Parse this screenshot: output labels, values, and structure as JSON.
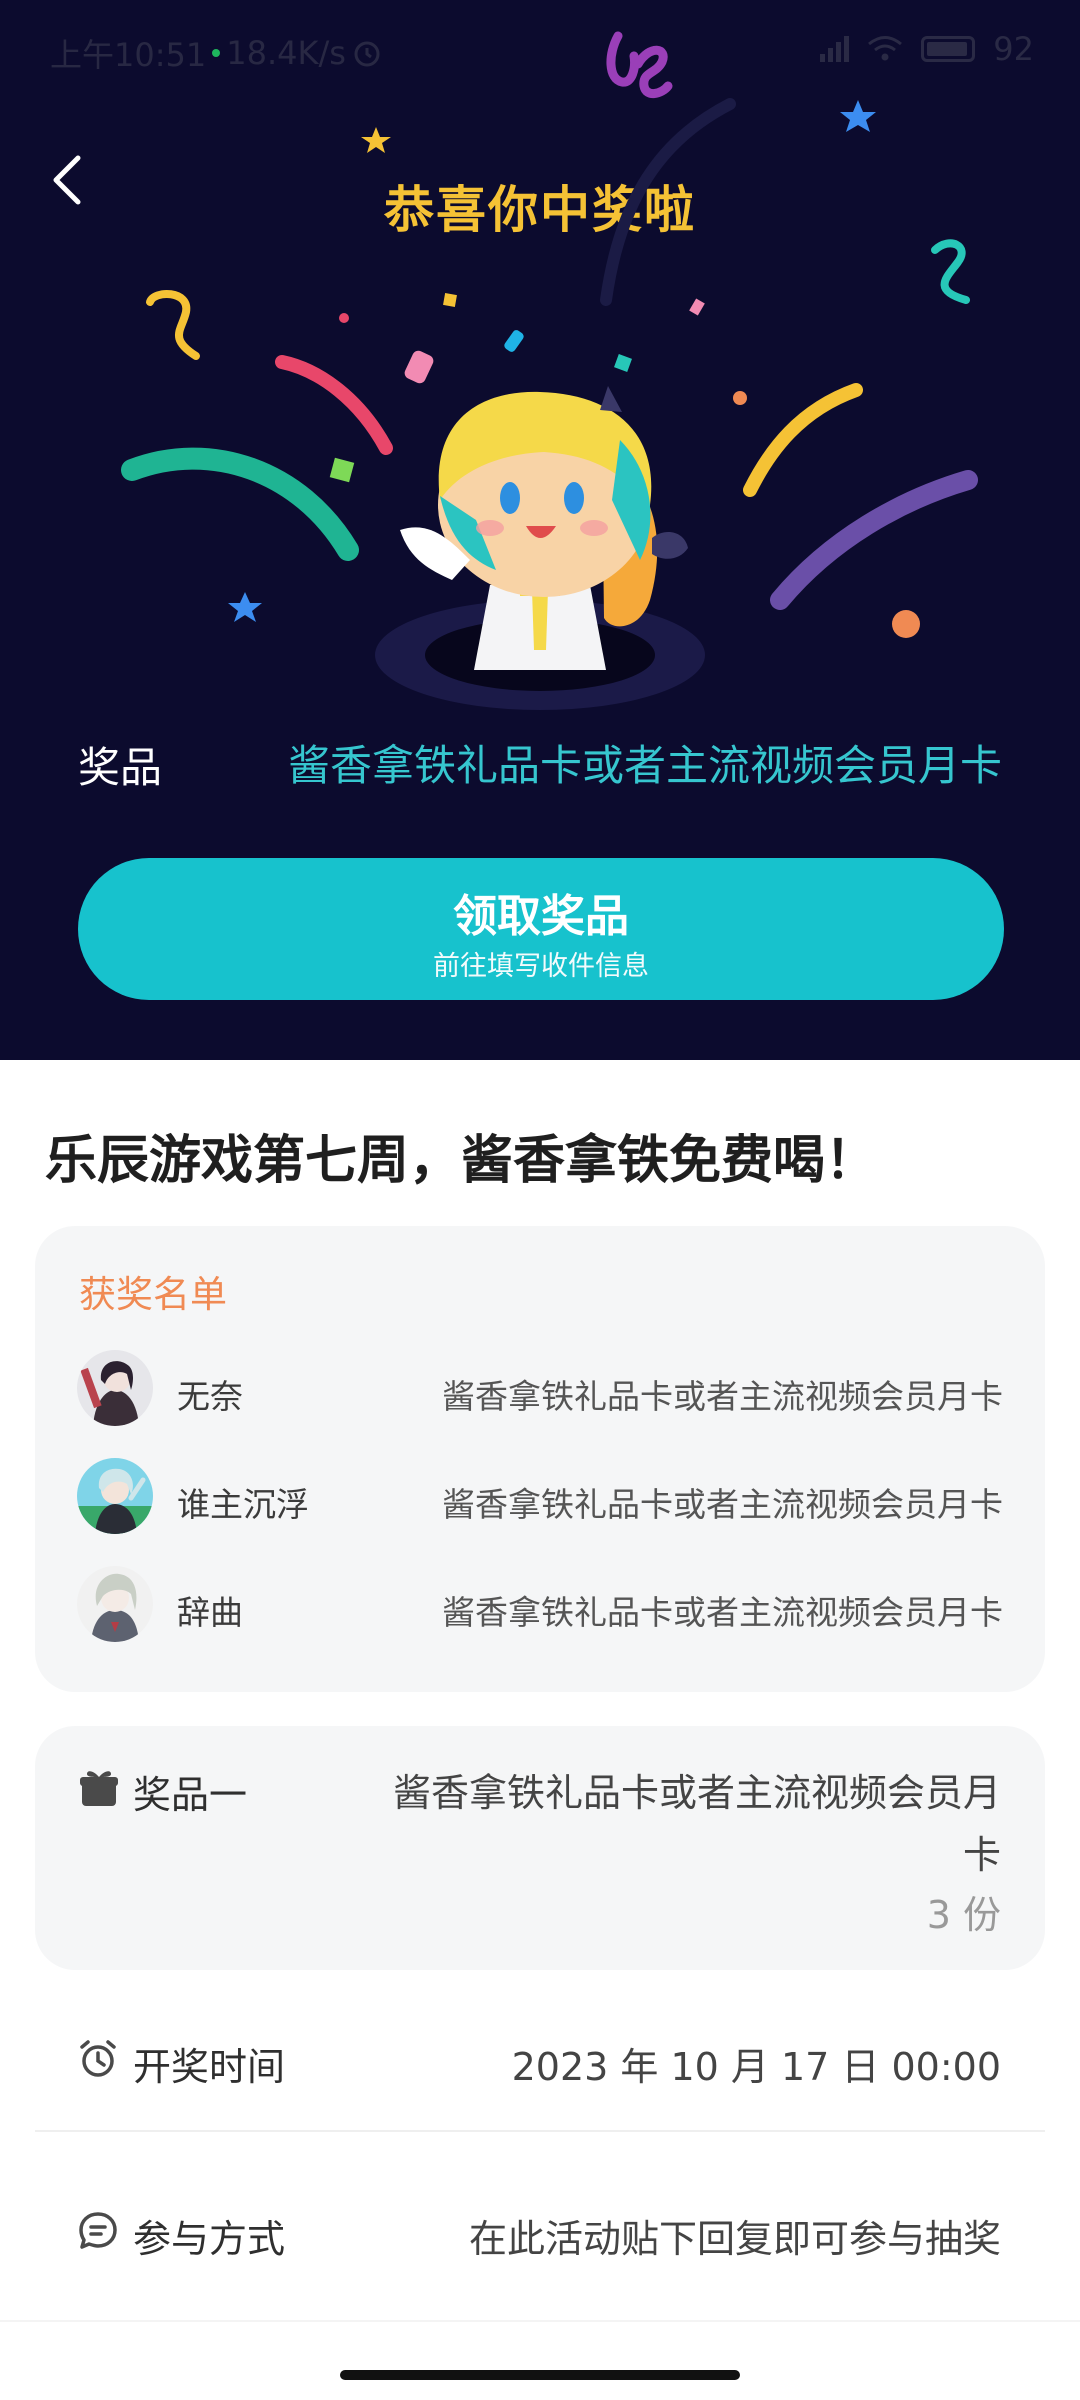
{
  "status_bar": {
    "time": "上午10:51",
    "speed": "18.4K/s",
    "battery": "92"
  },
  "hero": {
    "title": "恭喜你中奖啦",
    "prize_label": "奖品",
    "prize_value": "酱香拿铁礼品卡或者主流视频会员月卡",
    "claim_button": "领取奖品",
    "claim_subtext": "前往填写收件信息"
  },
  "activity": {
    "title": "乐辰游戏第七周，酱香拿铁免费喝！"
  },
  "winners": {
    "heading": "获奖名单",
    "list": [
      {
        "name": "无奈",
        "prize": "酱香拿铁礼品卡或者主流视频会员月卡"
      },
      {
        "name": "谁主沉浮",
        "prize": "酱香拿铁礼品卡或者主流视频会员月卡"
      },
      {
        "name": "辞曲",
        "prize": "酱香拿铁礼品卡或者主流视频会员月卡"
      }
    ]
  },
  "prize_card": {
    "label": "奖品一",
    "value": "酱香拿铁礼品卡或者主流视频会员月卡",
    "quantity": "3 份"
  },
  "draw_time": {
    "label": "开奖时间",
    "value": "2023 年 10 月 17 日 00:00"
  },
  "participation": {
    "label": "参与方式",
    "value": "在此活动贴下回复即可参与抽奖"
  },
  "colors": {
    "hero_bg": "#0c0b2e",
    "title_gold": "#f5c235",
    "accent_teal": "#17c2cd",
    "winners_heading": "#f08a53"
  }
}
